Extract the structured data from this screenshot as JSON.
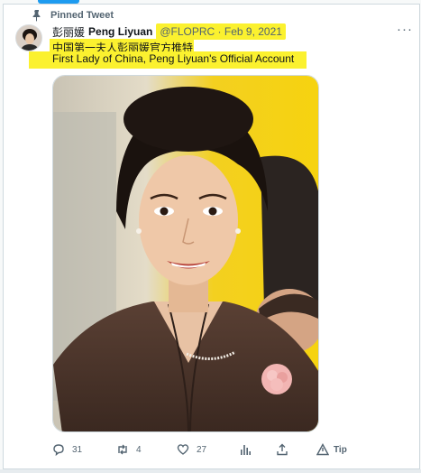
{
  "pinned": {
    "label": "Pinned Tweet",
    "icon": "pin-icon"
  },
  "author": {
    "name_cn": "彭丽媛",
    "display_name": "Peng Liyuan",
    "handle_date": "@FLOPRC · Feb 9, 2021"
  },
  "tweet": {
    "text_cn": "中国第一夫人彭丽媛官方推特",
    "text_en": "First Lady of China, Peng Liyuan's Official Account"
  },
  "actions": {
    "reply": {
      "icon": "reply-icon",
      "count": "31"
    },
    "retweet": {
      "icon": "retweet-icon",
      "count": "4"
    },
    "like": {
      "icon": "heart-icon",
      "count": "27"
    },
    "analytics": {
      "icon": "analytics-icon"
    },
    "share": {
      "icon": "share-icon"
    },
    "tip": {
      "icon": "tip-icon",
      "label": "Tip"
    }
  },
  "colors": {
    "highlight": "#fbf12f",
    "accent": "#1d9bf0",
    "muted": "#536471",
    "photo_background": "#f4cf12",
    "jacket": "#4a342c"
  }
}
